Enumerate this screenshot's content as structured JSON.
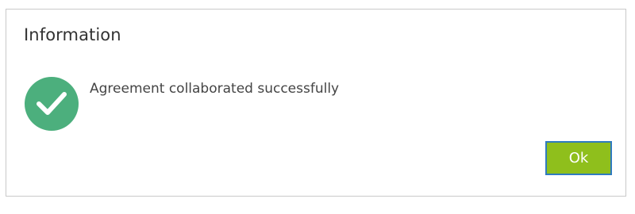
{
  "dialog": {
    "title": "Information",
    "message": "Agreement collaborated successfully",
    "icon": "checkmark-icon",
    "ok_label": "Ok"
  },
  "colors": {
    "success": "#4caf7d",
    "button": "#8fbf1c",
    "button_border": "#2f7bbf"
  }
}
